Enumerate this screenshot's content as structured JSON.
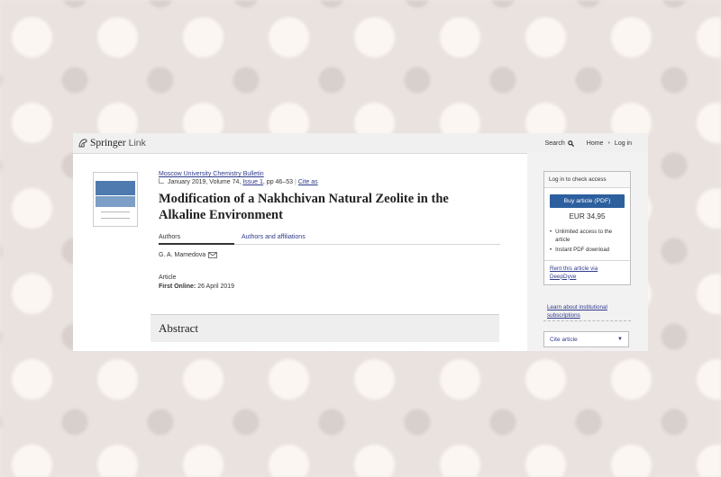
{
  "header": {
    "logo_springer": "Springer",
    "logo_link": "Link",
    "search_label": "Search",
    "home_label": "Home",
    "separator": "•",
    "login_label": "Log in"
  },
  "article": {
    "journal": "Moscow University Chemistry Bulletin",
    "date_volume": "January 2019, Volume 74,",
    "issue": "Issue 1",
    "pages": ", pp 46–53",
    "divider": "|",
    "cite_as": "Cite as",
    "title": "Modification of a Nakhchivan Natural Zeolite in the Alkaline Environment",
    "tabs": [
      "Authors",
      "Authors and affiliations"
    ],
    "author": "G. A. Mamedova",
    "type": "Article",
    "first_online_label": "First Online:",
    "first_online_date": "26 April 2019",
    "abstract_heading": "Abstract"
  },
  "sidebar": {
    "login_check": "Log in to check access",
    "buy_button": "Buy article (PDF)",
    "price": "EUR 34,95",
    "benefits": [
      "Unlimited access to the article",
      "Instant PDF download"
    ],
    "bullet": "•",
    "deepdyve": "Rent this article via DeepDyve",
    "institutional": "Learn about institutional subscriptions",
    "cite_article": "Cite article",
    "cite_caret": "▼"
  }
}
